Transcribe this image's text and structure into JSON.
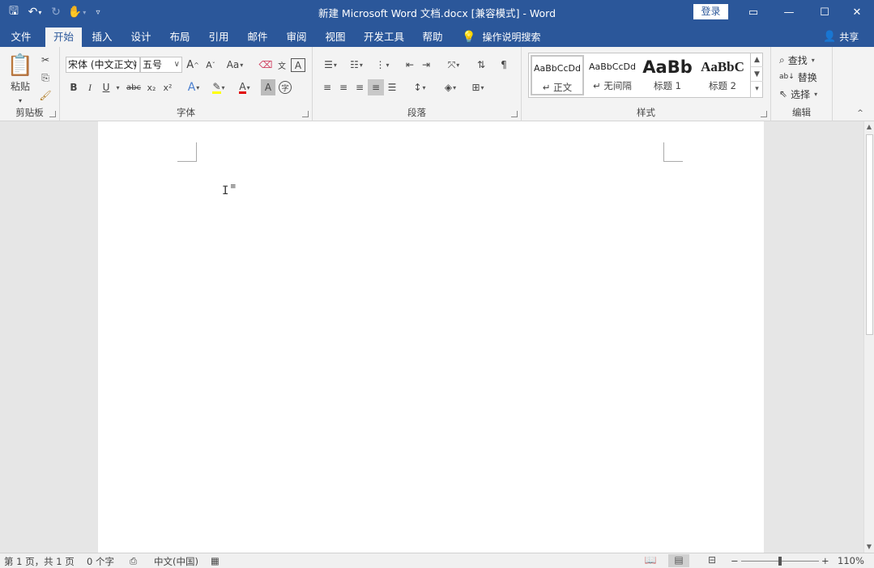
{
  "window": {
    "title": "新建 Microsoft Word 文档.docx [兼容模式]  -  Word",
    "signin_label": "登录"
  },
  "qat": {
    "save_icon": "save-icon",
    "undo_icon": "undo-icon",
    "redo_icon": "redo-icon",
    "touch_icon": "touch-mode-icon",
    "customize_icon": "customize-qat-icon"
  },
  "tabs": [
    {
      "label": "文件"
    },
    {
      "label": "开始",
      "active": true
    },
    {
      "label": "插入"
    },
    {
      "label": "设计"
    },
    {
      "label": "布局"
    },
    {
      "label": "引用"
    },
    {
      "label": "邮件"
    },
    {
      "label": "审阅"
    },
    {
      "label": "视图"
    },
    {
      "label": "开发工具"
    },
    {
      "label": "帮助"
    }
  ],
  "tell_me": "操作说明搜索",
  "share": "共享",
  "ribbon": {
    "clipboard": {
      "paste": "粘贴",
      "label": "剪贴板"
    },
    "font": {
      "label": "字体",
      "font_name": "宋体 (中文正文)",
      "font_size": "五号",
      "grow": "A",
      "shrink": "A",
      "case": "Aa",
      "bold": "B",
      "italic": "I",
      "underline": "U",
      "strike": "abc",
      "subscript": "x₂",
      "superscript": "x²",
      "text_effect": "A",
      "font_color": "A",
      "char_shading": "A",
      "enclose": "字",
      "phonetic": "文",
      "border": "A",
      "colors": {
        "highlight": "#ffff00",
        "font_color": "#e00000"
      }
    },
    "paragraph": {
      "label": "段落"
    },
    "styles": {
      "label": "样式",
      "items": [
        {
          "sample": "AaBbCcDd",
          "name": "↵ 正文"
        },
        {
          "sample": "AaBbCcDd",
          "name": "↵ 无间隔"
        },
        {
          "sample": "AaBb",
          "name": "标题 1"
        },
        {
          "sample": "AaBbC",
          "name": "标题 2"
        }
      ]
    },
    "editing": {
      "label": "编辑",
      "find": "查找",
      "replace": "替换",
      "select": "选择"
    }
  },
  "status": {
    "page": "第 1 页，共 1 页",
    "words": "0 个字",
    "language": "中文(中国)",
    "zoom": "110%",
    "zoom_minus": "−",
    "zoom_plus": "+",
    "zoom_level": 0.5
  }
}
